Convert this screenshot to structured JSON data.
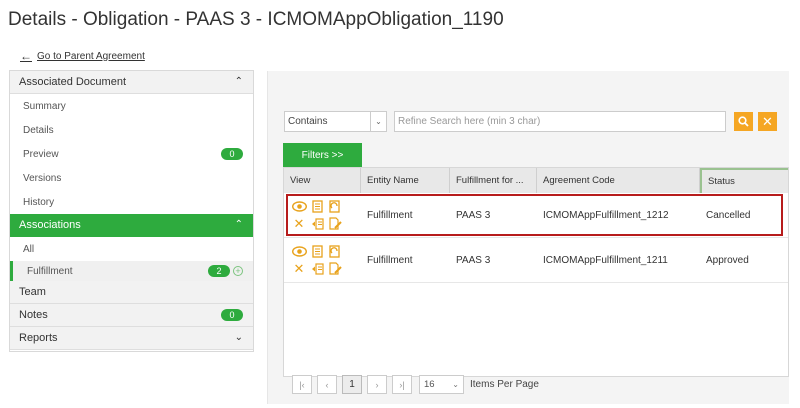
{
  "page_title": "Details - Obligation - PAAS 3 - ICMOMAppObligation_1190",
  "parent_link": "Go to Parent Agreement",
  "left_panel": {
    "associated_document": {
      "title": "Associated Document",
      "items": [
        {
          "label": "Summary"
        },
        {
          "label": "Details"
        },
        {
          "label": "Preview",
          "badge": "0"
        },
        {
          "label": "Versions"
        },
        {
          "label": "History"
        }
      ]
    },
    "associations": {
      "title": "Associations",
      "items": [
        {
          "label": "All"
        },
        {
          "label": "Fulfillment",
          "badge": "2"
        }
      ]
    },
    "team": {
      "title": "Team"
    },
    "notes": {
      "title": "Notes",
      "badge": "0"
    },
    "reports": {
      "title": "Reports"
    }
  },
  "search": {
    "operator": "Contains",
    "placeholder": "Refine Search here (min 3 char)"
  },
  "filters_label": "Filters >>",
  "grid": {
    "columns": [
      "View",
      "Entity Name",
      "Fulfillment for ...",
      "Agreement Code",
      "Status"
    ],
    "rows": [
      {
        "entity_name": "Fulfillment",
        "fulfillment_for": "PAAS 3",
        "agreement_code": "ICMOMAppFulfillment_1212",
        "status": "Cancelled"
      },
      {
        "entity_name": "Fulfillment",
        "fulfillment_for": "PAAS 3",
        "agreement_code": "ICMOMAppFulfillment_1211",
        "status": "Approved"
      }
    ]
  },
  "pager": {
    "current_page": "1",
    "page_size": "16",
    "items_per_page_label": "Items Per Page"
  },
  "colors": {
    "accent_green": "#2eab3e",
    "action_orange": "#f5a623",
    "highlight_red": "#b71c1c"
  }
}
